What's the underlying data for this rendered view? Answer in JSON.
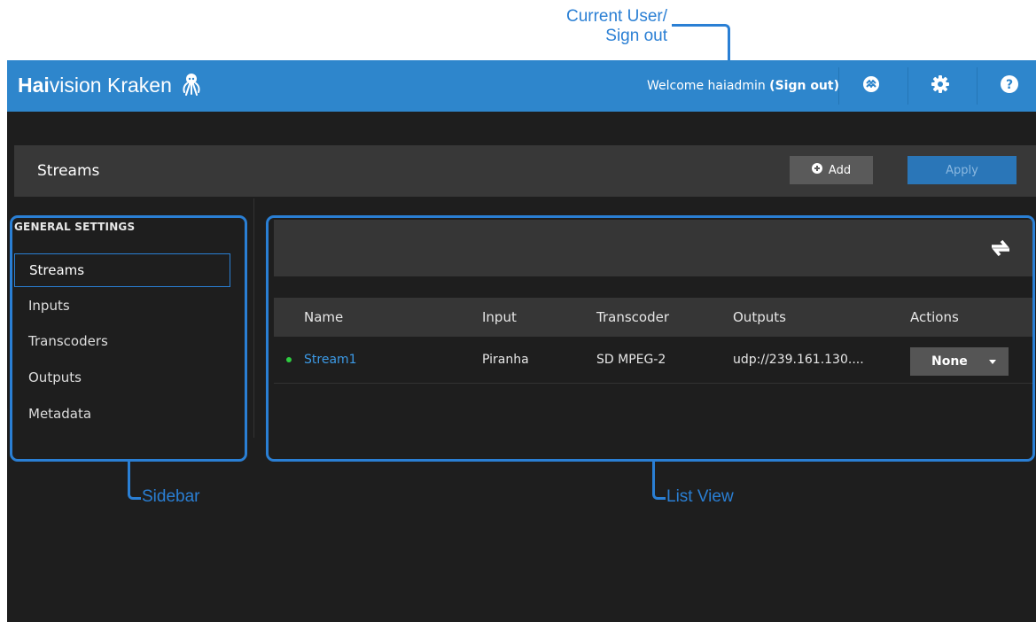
{
  "annotations": {
    "current_user": [
      "Current User/",
      "Sign out"
    ],
    "sidebar": "Sidebar",
    "list_view": "List View"
  },
  "header": {
    "brand_bold": "Hai",
    "brand_rest": "vision Kraken",
    "welcome": "Welcome haiadmin",
    "signout": "(Sign out)",
    "icons": [
      "status-icon",
      "gear-icon",
      "help-icon"
    ]
  },
  "toolbar": {
    "title": "Streams",
    "add_label": "Add",
    "apply_label": "Apply"
  },
  "sidebar": {
    "heading": "GENERAL SETTINGS",
    "items": [
      {
        "label": "Streams",
        "active": true
      },
      {
        "label": "Inputs"
      },
      {
        "label": "Transcoders"
      },
      {
        "label": "Outputs"
      },
      {
        "label": "Metadata"
      }
    ]
  },
  "list": {
    "columns": [
      "Name",
      "Input",
      "Transcoder",
      "Outputs",
      "Actions"
    ],
    "rows": [
      {
        "status": "active",
        "name": "Stream1",
        "input": "Piranha",
        "transcoder": "SD MPEG-2",
        "outputs": "udp://239.161.130....",
        "action": "None"
      }
    ]
  },
  "colors": {
    "accent": "#2e86cc",
    "annotation": "#2a7fd4",
    "status_ok": "#2ecc40"
  }
}
